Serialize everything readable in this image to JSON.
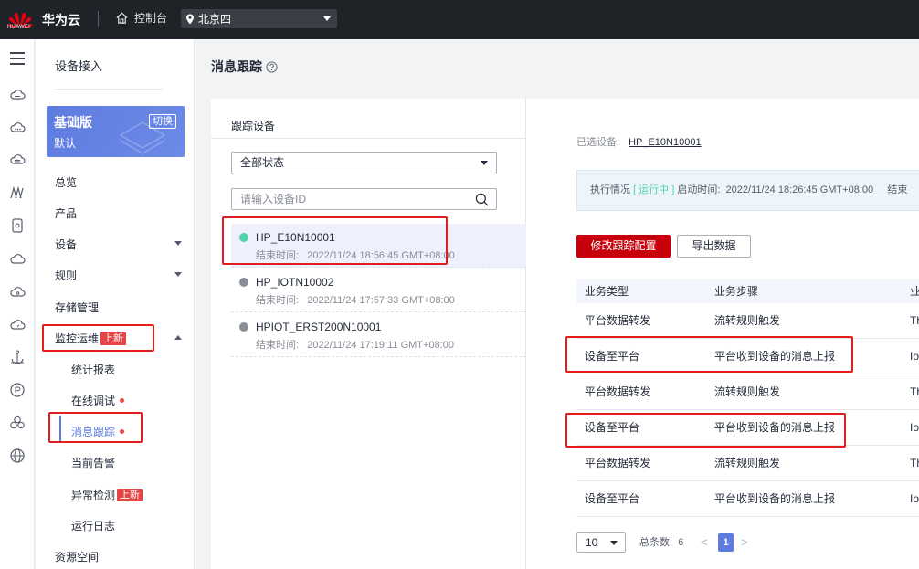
{
  "topbar": {
    "logo_text": "HUAWEI",
    "brand": "华为云",
    "console": "控制台",
    "region": "北京四"
  },
  "rail": {
    "icons": [
      "menu-icon",
      "cloud-icon",
      "cloud-server-icon",
      "database-icon",
      "network-icon",
      "storage-icon",
      "cloud-upload-icon",
      "cloud-gear-icon",
      "cloud-dashboard-icon",
      "anchor-icon",
      "shield-icon",
      "cluster-icon",
      "globe-icon"
    ]
  },
  "sidenav": {
    "title": "设备接入",
    "plan": {
      "name": "基础版",
      "sub": "默认",
      "switch": "切换"
    },
    "items": [
      {
        "label": "总览"
      },
      {
        "label": "产品"
      },
      {
        "label": "设备"
      },
      {
        "label": "规则"
      },
      {
        "label": "存储管理"
      },
      {
        "label": "监控运维",
        "tag": "上新"
      },
      {
        "label": "资源空间"
      }
    ],
    "sub_items": [
      {
        "label": "统计报表"
      },
      {
        "label": "在线调试"
      },
      {
        "label": "消息跟踪"
      },
      {
        "label": "当前告警"
      },
      {
        "label": "异常检测",
        "tag": "上新"
      },
      {
        "label": "运行日志"
      }
    ]
  },
  "page": {
    "title": "消息跟踪"
  },
  "left": {
    "title": "跟踪设备",
    "status_select": "全部状态",
    "search_placeholder": "请输入设备ID",
    "devices": [
      {
        "name": "HP_E10N10001",
        "time_label": "结束时间:",
        "time": "2022/11/24 18:56:45 GMT+08:00",
        "status": "running"
      },
      {
        "name": "HP_IOTN10002",
        "time_label": "结束时间:",
        "time": "2022/11/24 17:57:33 GMT+08:00",
        "status": "stopped"
      },
      {
        "name": "HPIOT_ERST200N10001",
        "time_label": "结束时间:",
        "time": "2022/11/24 17:19:11 GMT+08:00",
        "status": "stopped"
      }
    ]
  },
  "right": {
    "selected_label": "已选设备:",
    "selected_device": "HP_E10N10001",
    "exec": {
      "label": "执行情况",
      "status": "[ 运行中 ]",
      "start_label": "启动时间:",
      "start_time": "2022/11/24 18:26:45 GMT+08:00",
      "end_label": "结束"
    },
    "btn_modify": "修改跟踪配置",
    "btn_export": "导出数据",
    "table": {
      "headers": [
        "业务类型",
        "业务步骤",
        "业"
      ],
      "rows": [
        [
          "平台数据转发",
          "流转规则触发",
          "Th"
        ],
        [
          "设备至平台",
          "平台收到设备的消息上报",
          "Io"
        ],
        [
          "平台数据转发",
          "流转规则触发",
          "Th"
        ],
        [
          "设备至平台",
          "平台收到设备的消息上报",
          "Io"
        ],
        [
          "平台数据转发",
          "流转规则触发",
          "Th"
        ],
        [
          "设备至平台",
          "平台收到设备的消息上报",
          "Io"
        ]
      ]
    },
    "pager": {
      "page_size": "10",
      "total_label": "总条数:",
      "total": "6",
      "current": "1",
      "prev": "<",
      "next": ">"
    }
  },
  "colors": {
    "accent": "#5e7ce0",
    "primary_button": "#c7000b",
    "annotation": "#e21d1d",
    "running": "#50d4ab"
  }
}
